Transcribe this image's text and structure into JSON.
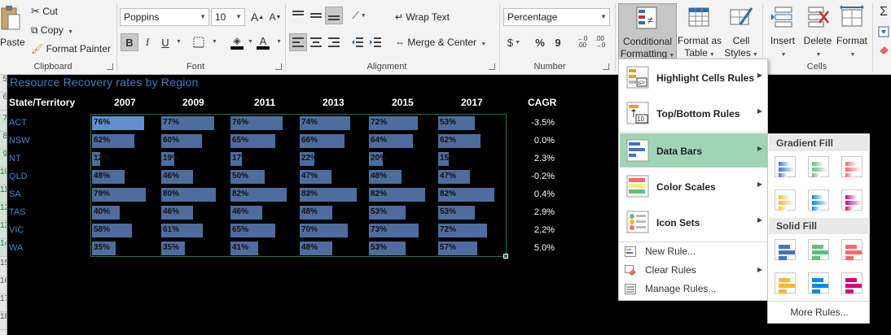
{
  "ribbon": {
    "clipboard": {
      "paste": "Paste",
      "cut": "Cut",
      "copy": "Copy",
      "format_painter": "Format Painter",
      "label": "Clipboard"
    },
    "font": {
      "name": "Poppins",
      "size": "10",
      "label": "Font",
      "grow": "A",
      "shrink": "A"
    },
    "alignment": {
      "wrap_text": "Wrap Text",
      "merge_center": "Merge & Center",
      "label": "Alignment"
    },
    "number": {
      "format": "Percentage",
      "currency": "$",
      "percent": "%",
      "comma": "9",
      "label": "Number"
    },
    "styles": {
      "conditional_formatting": "Conditional",
      "conditional_formatting_2": "Formatting",
      "format_as_table": "Format as",
      "format_as_table_2": "Table",
      "cell_styles": "Cell",
      "cell_styles_2": "Styles"
    },
    "cells": {
      "insert": "Insert",
      "delete": "Delete",
      "format": "Format",
      "label": "Cells"
    }
  },
  "sheet": {
    "title": "Resource Recovery rates by Region",
    "header_state": "State/Territory",
    "years": [
      "2007",
      "2009",
      "2011",
      "2013",
      "2015",
      "2017"
    ],
    "header_cagr": "CAGR",
    "row_numbers": [
      "5",
      "6",
      "7",
      "8",
      "9",
      "10",
      "11",
      "12",
      "13",
      "14",
      "15",
      "16",
      "17",
      "18"
    ],
    "rows": [
      {
        "region": "ACT",
        "values": [
          "76%",
          "77%",
          "76%",
          "74%",
          "72%",
          "53%"
        ],
        "pct": [
          76,
          77,
          76,
          74,
          72,
          53
        ],
        "cagr": "-3.5%"
      },
      {
        "region": "NSW",
        "values": [
          "62%",
          "60%",
          "65%",
          "66%",
          "64%",
          "62%"
        ],
        "pct": [
          62,
          60,
          65,
          66,
          64,
          62
        ],
        "cagr": "0.0%"
      },
      {
        "region": "NT",
        "values": [
          "12%",
          "19%",
          "17%",
          "22%",
          "20%",
          "15%"
        ],
        "pct": [
          12,
          19,
          17,
          22,
          20,
          15
        ],
        "cagr": "2.3%"
      },
      {
        "region": "QLD",
        "values": [
          "48%",
          "46%",
          "50%",
          "47%",
          "48%",
          "47%"
        ],
        "pct": [
          48,
          46,
          50,
          47,
          48,
          47
        ],
        "cagr": "-0.2%"
      },
      {
        "region": "SA",
        "values": [
          "79%",
          "80%",
          "82%",
          "83%",
          "82%",
          "82%"
        ],
        "pct": [
          79,
          80,
          82,
          83,
          82,
          82
        ],
        "cagr": "0.4%"
      },
      {
        "region": "TAS",
        "values": [
          "40%",
          "46%",
          "46%",
          "48%",
          "53%",
          "53%"
        ],
        "pct": [
          40,
          46,
          46,
          48,
          53,
          53
        ],
        "cagr": "2.9%"
      },
      {
        "region": "VIC",
        "values": [
          "58%",
          "61%",
          "65%",
          "70%",
          "73%",
          "72%"
        ],
        "pct": [
          58,
          61,
          65,
          70,
          73,
          72
        ],
        "cagr": "2.2%"
      },
      {
        "region": "WA",
        "values": [
          "35%",
          "35%",
          "41%",
          "48%",
          "53%",
          "57%"
        ],
        "pct": [
          35,
          35,
          41,
          48,
          53,
          57
        ],
        "cagr": "5.0%"
      }
    ]
  },
  "cf_menu": {
    "highlight": "Highlight Cells Rules",
    "topbottom": "Top/Bottom Rules",
    "databars": "Data Bars",
    "colorscales": "Color Scales",
    "iconsets": "Icon Sets",
    "newrule": "New Rule...",
    "clearrules": "Clear Rules",
    "managerules": "Manage Rules..."
  },
  "databars_submenu": {
    "gradient_fill": "Gradient Fill",
    "solid_fill": "Solid Fill",
    "more_rules": "More Rules...",
    "colors": [
      "#4472c4",
      "#63be7b",
      "#f8696b",
      "#ffb628",
      "#008aef",
      "#d6007b"
    ]
  },
  "colors": {
    "bar": "#4d6d9e",
    "bar_highlight": "#5f8fcc",
    "title": "#3a7ec6",
    "region": "#4a86c8",
    "active_menu": "#9fd5b5",
    "selection": "#1e7145"
  }
}
